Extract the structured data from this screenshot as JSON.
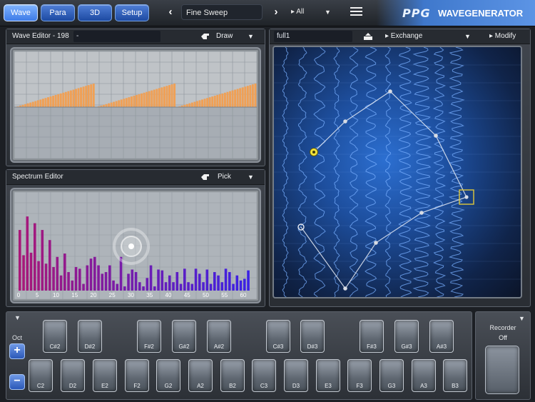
{
  "toolbar": {
    "tabs": [
      {
        "label": "Wave",
        "active": true
      },
      {
        "label": "Para",
        "active": false
      },
      {
        "label": "3D",
        "active": false
      },
      {
        "label": "Setup",
        "active": false
      }
    ],
    "prev_icon": "chevron-left-icon",
    "next_icon": "chevron-right-icon",
    "preset_name": "Fine Sweep",
    "category": "▸ All",
    "category_chevron": "▼",
    "menu_icon": "hamburger-menu-icon"
  },
  "brand": {
    "logo": "PPG",
    "name": "WAVEGENERATOR",
    "accent_color": "#3f78cc"
  },
  "wave_editor": {
    "title": "Wave Editor - 198",
    "field_value": "-",
    "tool_icon": "hand-icon",
    "tool_label": "Draw",
    "chevron": "▼",
    "sawtooth_cycles": 3,
    "bar_color": "#f0a055"
  },
  "spectrum_editor": {
    "title": "Spectrum Editor",
    "tool_icon": "hand-icon",
    "tool_label": "Pick",
    "chevron": "▼",
    "axis_labels": [
      "0",
      "5",
      "10",
      "15",
      "20",
      "25",
      "30",
      "35",
      "40",
      "45",
      "50",
      "55",
      "60"
    ],
    "harmonic_levels": [
      0.72,
      0.42,
      0.88,
      0.45,
      0.8,
      0.35,
      0.72,
      0.32,
      0.6,
      0.28,
      0.4,
      0.18,
      0.44,
      0.22,
      0.12,
      0.28,
      0.26,
      0.08,
      0.3,
      0.38,
      0.4,
      0.3,
      0.2,
      0.22,
      0.3,
      0.12,
      0.08,
      0.4,
      0.05,
      0.2,
      0.25,
      0.22,
      0.1,
      0.05,
      0.15,
      0.3,
      0.05,
      0.25,
      0.24,
      0.1,
      0.18,
      0.1,
      0.22,
      0.08,
      0.26,
      0.1,
      0.08,
      0.26,
      0.2,
      0.1,
      0.25,
      0.08,
      0.22,
      0.18,
      0.1,
      0.26,
      0.22,
      0.08,
      0.18,
      0.12,
      0.14,
      0.24
    ]
  },
  "wavetable": {
    "name": "full1",
    "exchange_icon": "exchange-icon",
    "exchange_label": "▸ Exchange",
    "exchange_chevron": "▼",
    "modify_label": "▸ Modify"
  },
  "keyboard": {
    "chevron": "▼",
    "octave_label": "Oct",
    "octave_up": "+",
    "octave_down": "−",
    "black_keys": [
      "C#2",
      "D#2",
      "F#2",
      "G#2",
      "A#2",
      "C#3",
      "D#3",
      "F#3",
      "G#3",
      "A#3"
    ],
    "white_keys": [
      "C2",
      "D2",
      "E2",
      "F2",
      "G2",
      "A2",
      "B2",
      "C3",
      "D3",
      "E3",
      "F3",
      "G3",
      "A3",
      "B3"
    ]
  },
  "recorder": {
    "label": "Recorder",
    "state": "Off",
    "chevron": "▼"
  }
}
